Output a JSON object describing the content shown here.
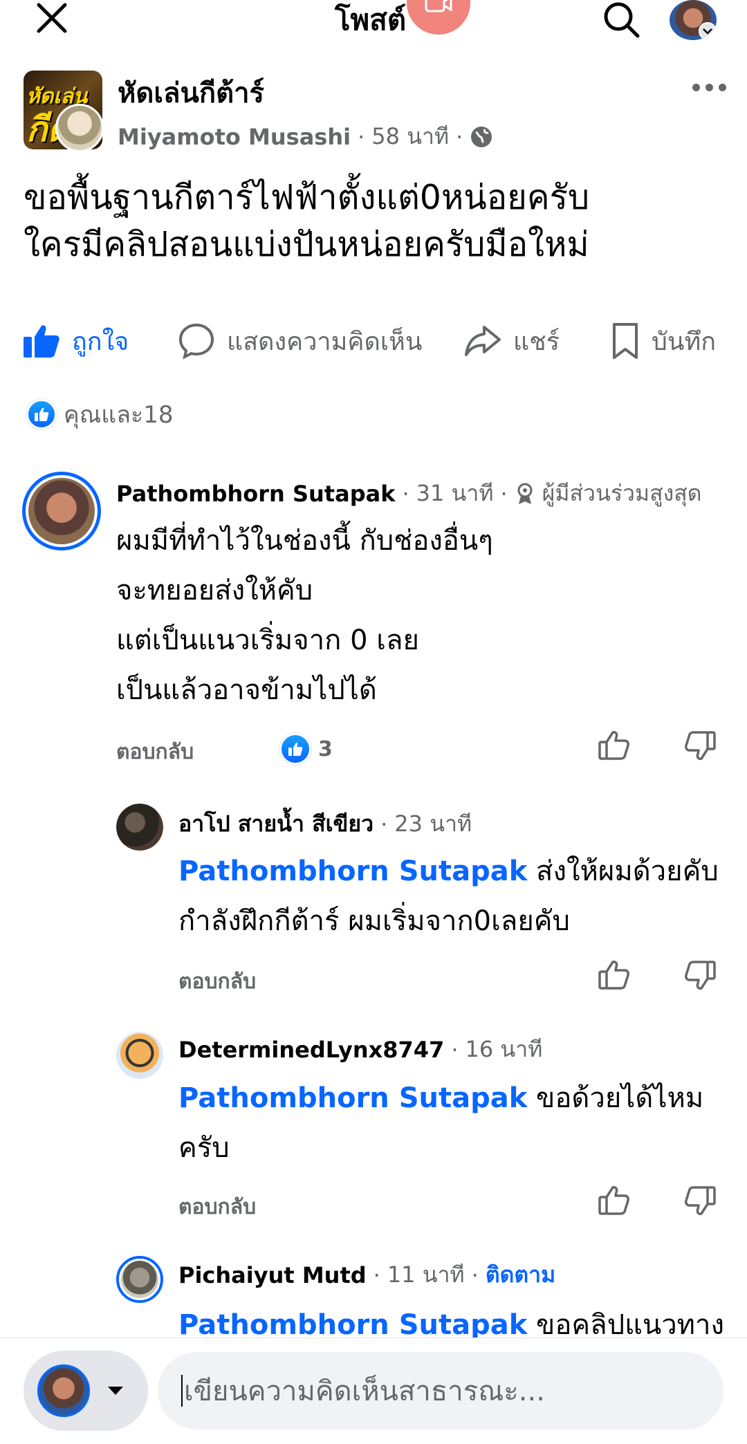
{
  "header": {
    "title": "โพสต์",
    "close_icon": "close-icon",
    "search_icon": "search-icon"
  },
  "post": {
    "group_name": "หัดเล่นกีต้าร์",
    "group_thumb_line1": "หัดเล่น",
    "group_thumb_line2": "กีต้",
    "author": "Miyamoto Musashi",
    "time": "58 นาที",
    "dot": "·",
    "privacy_icon": "globe-icon",
    "text_line1": "ขอพื้นฐานกีตาร์ไฟฟ้าตั้งแต่0หน่อยครับ",
    "text_line2": "ใครมีคลิปสอนแบ่งปันหน่อยครับมือใหม่"
  },
  "actions": {
    "like": "ถูกใจ",
    "comment": "แสดงความคิดเห็น",
    "share": "แชร์",
    "save": "บันทึก"
  },
  "reactions": {
    "summary": "คุณและ18"
  },
  "comments": [
    {
      "name": "Pathombhorn Sutapak",
      "time": "31 นาที",
      "badge": "ผู้มีส่วนร่วมสูงสุด",
      "lines": [
        "ผมมีที่ทำไว้ในช่องนี้ กับช่องอื่นๆ",
        "จะทยอยส่งให้คับ",
        "แต่เป็นแนวเริ่มจาก 0 เลย",
        "เป็นแล้วอาจข้ามไปได้"
      ],
      "reply": "ตอบกลับ",
      "likes": "3"
    },
    {
      "name": "อาโป สายน้ำ สีเขียว",
      "time": "23 นาที",
      "mention": "Pathombhorn Sutapak",
      "text1": " ส่งให้ผมด้วยคับ",
      "text2": "กำลังฝึกกีต้าร์ ผมเริ่มจาก0เลยคับ",
      "reply": "ตอบกลับ"
    },
    {
      "name": "DeterminedLynx8747",
      "time": "16 นาที",
      "mention": "Pathombhorn Sutapak",
      "text1": " ขอด้วยได้ไหม",
      "text2": "ครับ",
      "reply": "ตอบกลับ"
    },
    {
      "name": "Pichaiyut Mutd",
      "time": "11 นาที",
      "follow": "ติดตาม",
      "mention": "Pathombhorn Sutapak",
      "text1": " ขอคลิปแนวทาง"
    }
  ],
  "composer": {
    "placeholder": "เขียนความคิดเห็นสาธารณะ..."
  },
  "colors": {
    "accent": "#0866ff",
    "secondary_text": "#65676b",
    "input_bg": "#f0f2f5"
  }
}
